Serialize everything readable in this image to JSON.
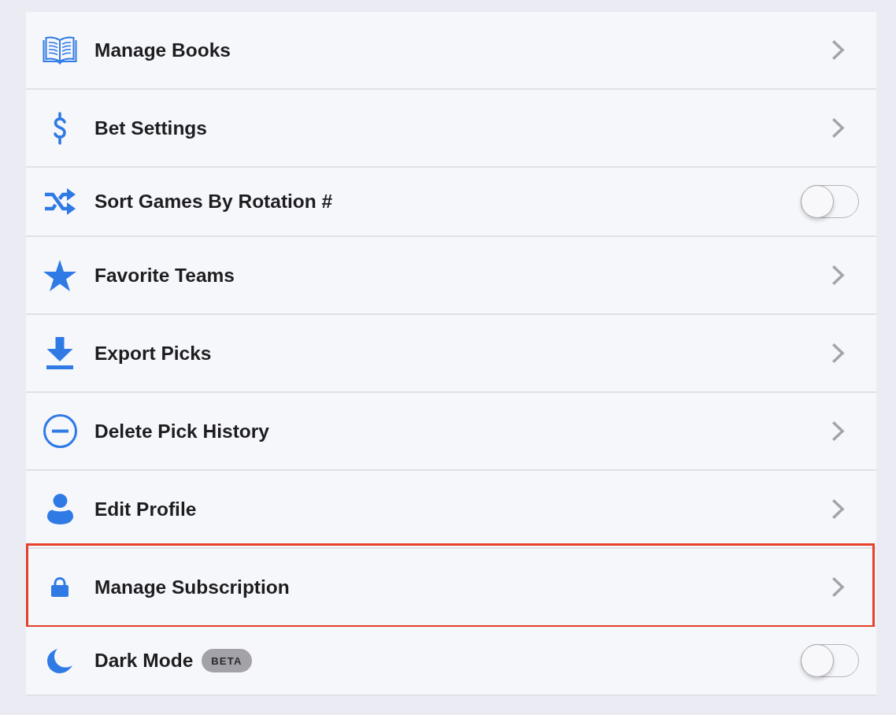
{
  "settings": {
    "items": [
      {
        "kind": "link",
        "label": "Manage Books",
        "highlighted": false
      },
      {
        "kind": "link",
        "label": "Bet Settings",
        "highlighted": false
      },
      {
        "kind": "toggle",
        "label": "Sort Games By Rotation #",
        "on": false,
        "highlighted": false
      },
      {
        "kind": "link",
        "label": "Favorite Teams",
        "highlighted": false
      },
      {
        "kind": "link",
        "label": "Export Picks",
        "highlighted": false
      },
      {
        "kind": "link",
        "label": "Delete Pick History",
        "highlighted": false
      },
      {
        "kind": "link",
        "label": "Edit Profile",
        "highlighted": false
      },
      {
        "kind": "link",
        "label": "Manage Subscription",
        "highlighted": true
      },
      {
        "kind": "toggle",
        "label": "Dark Mode",
        "badge": "BETA",
        "on": false,
        "highlighted": false
      }
    ]
  }
}
